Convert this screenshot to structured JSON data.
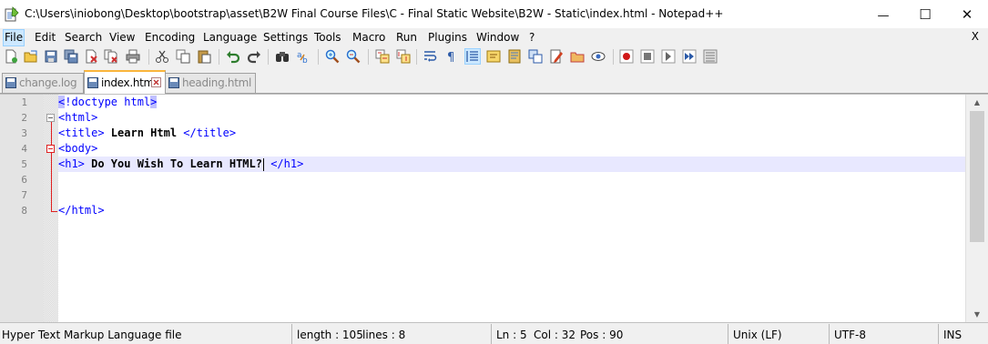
{
  "window": {
    "title": "C:\\Users\\iniobong\\Desktop\\bootstrap\\asset\\B2W Final Course Files\\C - Final Static Website\\B2W - Static\\index.html - Notepad++",
    "minimize_glyph": "—",
    "maximize_glyph": "☐",
    "close_glyph": "✕"
  },
  "menu": {
    "items": [
      "File",
      "Edit",
      "Search",
      "View",
      "Encoding",
      "Language",
      "Settings",
      "Tools",
      "Macro",
      "Run",
      "Plugins",
      "Window",
      "?"
    ],
    "close_label": "X"
  },
  "toolbar": {
    "icons": [
      "new-file-icon",
      "open-file-icon",
      "save-icon",
      "save-all-icon",
      "close-icon",
      "close-all-icon",
      "print-icon",
      "cut-icon",
      "copy-icon",
      "paste-icon",
      "undo-icon",
      "redo-icon",
      "find-icon",
      "replace-icon",
      "zoom-in-icon",
      "zoom-out-icon",
      "sync-vertical-icon",
      "sync-horizontal-icon",
      "word-wrap-icon",
      "show-all-characters-icon",
      "indent-guide-icon",
      "user-defined-language-icon",
      "document-map-icon",
      "function-list-icon",
      "folder-as-workspace-icon",
      "monitoring-icon",
      "record-macro-icon",
      "stop-recording-icon",
      "playback-macro-icon",
      "run-macro-multiple-icon",
      "save-macro-icon"
    ]
  },
  "tabs": [
    {
      "label": "change.log",
      "active": false
    },
    {
      "label": "index.html",
      "active": true
    },
    {
      "label": "heading.html",
      "active": false
    }
  ],
  "editor": {
    "line_numbers": [
      "1",
      "2",
      "3",
      "4",
      "5",
      "6",
      "7",
      "8"
    ],
    "lines": {
      "l1": {
        "a": "<",
        "b": "!doctype html",
        "c": ">"
      },
      "l2": {
        "a": "<html>"
      },
      "l3": {
        "a": "<title>",
        "b": " Learn Html ",
        "c": "</title>"
      },
      "l4": {
        "a": "<body>"
      },
      "l5": {
        "a": "<h1>",
        "b": " Do You Wish To Learn HTML?",
        "c": " </h1>"
      },
      "l8": {
        "a": "</html>"
      }
    }
  },
  "status": {
    "file_type": "Hyper Text Markup Language file",
    "length": "length : 105",
    "lines": "lines : 8",
    "ln": "Ln : 5",
    "col": "Col : 32",
    "pos": "Pos : 90",
    "eol": "Unix (LF)",
    "encoding": "UTF-8",
    "mode": "INS"
  }
}
